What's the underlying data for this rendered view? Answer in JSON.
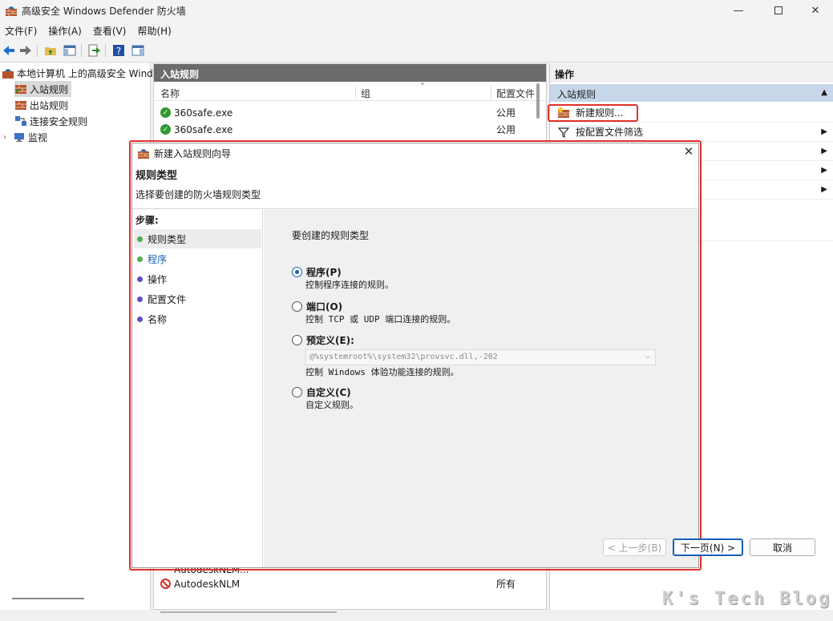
{
  "window": {
    "title": "高级安全 Windows Defender 防火墙"
  },
  "menu": [
    "文件(F)",
    "操作(A)",
    "查看(V)",
    "帮助(H)"
  ],
  "tree": {
    "root": "本地计算机 上的高级安全 Windows",
    "items": [
      "入站规则",
      "出站规则",
      "连接安全规则",
      "监视"
    ]
  },
  "list": {
    "header": "入站规则",
    "columns": {
      "name": "名称",
      "group": "组",
      "profile": "配置文件"
    },
    "rows": [
      {
        "name": "360safe.exe",
        "profile": "公用",
        "status": "allowed"
      },
      {
        "name": "360safe.exe",
        "profile": "公用",
        "status": "allowed"
      }
    ],
    "partial_row": "AutodeskNLM...",
    "bottom_row": {
      "name": "AutodeskNLM",
      "profile": "所有",
      "status": "blocked"
    }
  },
  "actions": {
    "header": "操作",
    "section": "入站规则",
    "items": [
      "新建规则...",
      "按配置文件筛选"
    ]
  },
  "wizard": {
    "title": "新建入站规则向导",
    "heading": "规则类型",
    "subheading": "选择要创建的防火墙规则类型",
    "steps_title": "步骤:",
    "steps": [
      {
        "label": "规则类型",
        "color": "#4caf50",
        "current": true
      },
      {
        "label": "程序",
        "color": "#4caf50",
        "current": false
      },
      {
        "label": "操作",
        "color": "#5b4fc7",
        "current": false
      },
      {
        "label": "配置文件",
        "color": "#5b4fc7",
        "current": false
      },
      {
        "label": "名称",
        "color": "#5b4fc7",
        "current": false
      }
    ],
    "prompt": "要创建的规则类型",
    "options": [
      {
        "label": "程序(P)",
        "desc": "控制程序连接的规则。",
        "checked": true
      },
      {
        "label": "端口(O)",
        "desc": "控制 TCP 或 UDP 端口连接的规则。",
        "checked": false
      },
      {
        "label": "预定义(E):",
        "desc": "控制 Windows 体验功能连接的规则。",
        "checked": false
      },
      {
        "label": "自定义(C)",
        "desc": "自定义规则。",
        "checked": false
      }
    ],
    "predefined_value": "@%systemroot%\\system32\\provsvc.dll,-202",
    "buttons": {
      "back": "< 上一步(B)",
      "next": "下一页(N) >",
      "cancel": "取消"
    }
  },
  "watermark": "K's Tech Blog"
}
